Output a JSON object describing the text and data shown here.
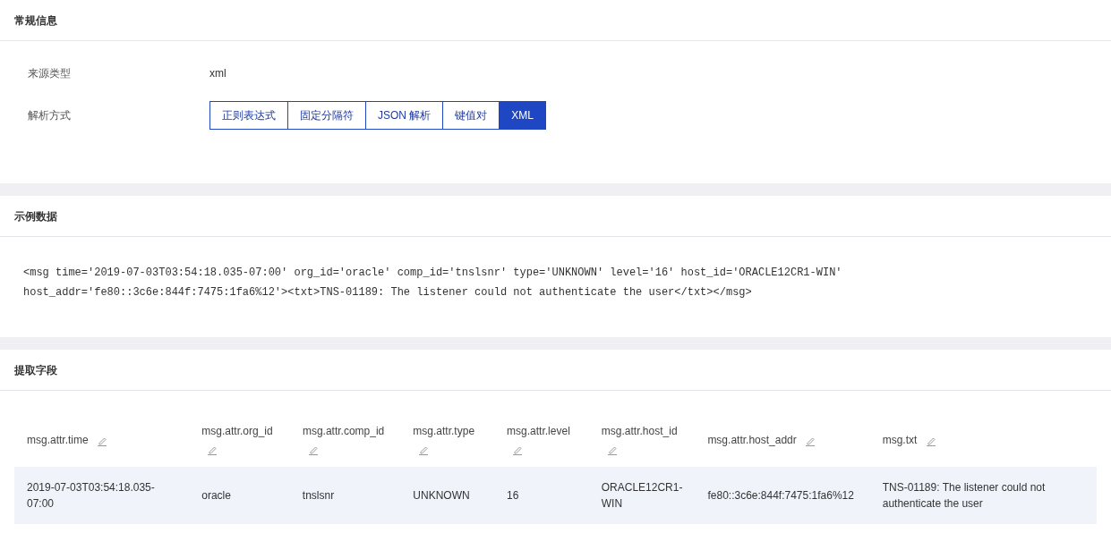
{
  "general": {
    "title": "常规信息",
    "source_type": {
      "label": "来源类型",
      "value": "xml"
    },
    "parse_mode": {
      "label": "解析方式",
      "options": [
        {
          "label": "正则表达式",
          "selected": false
        },
        {
          "label": "固定分隔符",
          "selected": false
        },
        {
          "label": "JSON 解析",
          "selected": false
        },
        {
          "label": "键值对",
          "selected": false
        },
        {
          "label": "XML",
          "selected": true
        }
      ]
    }
  },
  "sample": {
    "title": "示例数据",
    "lines": [
      "<msg time='2019-07-03T03:54:18.035-07:00' org_id='oracle' comp_id='tnslsnr' type='UNKNOWN' level='16' host_id='ORACLE12CR1-WIN'",
      "host_addr='fe80::3c6e:844f:7475:1fa6%12'><txt>TNS-01189: The listener could not authenticate the user</txt></msg>"
    ]
  },
  "fields": {
    "title": "提取字段",
    "table": {
      "columns": [
        "msg.attr.time",
        "msg.attr.org_id",
        "msg.attr.comp_id",
        "msg.attr.type",
        "msg.attr.level",
        "msg.attr.host_id",
        "msg.attr.host_addr",
        "msg.txt"
      ],
      "rows": [
        [
          "2019-07-03T03:54:18.035-07:00",
          "oracle",
          "tnslsnr",
          "UNKNOWN",
          "16",
          "ORACLE12CR1-WIN",
          "fe80::3c6e:844f:7475:1fa6%12",
          "TNS-01189: The listener could not authenticate the user"
        ]
      ]
    }
  }
}
